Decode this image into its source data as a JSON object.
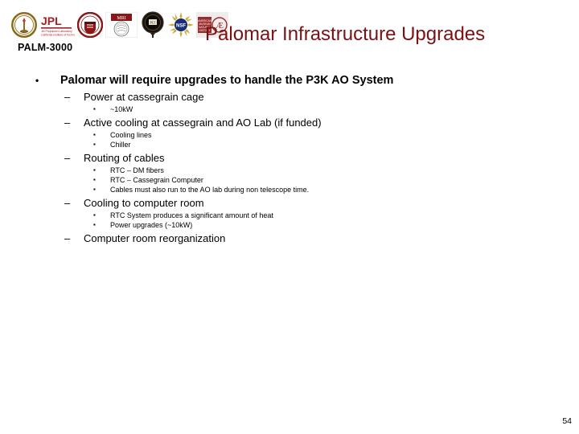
{
  "header": {
    "palm_label": "PALM-3000",
    "title": "Palomar Infrastructure Upgrades",
    "title_color": "#7B1113",
    "logos": [
      {
        "name": "caltech-seal-logo",
        "alt": "Caltech seal"
      },
      {
        "name": "jpl-logo",
        "alt": "JPL Jet Propulsion Laboratory California Institute of Technology"
      },
      {
        "name": "cornell-seal-logo",
        "alt": "Cornell University seal"
      },
      {
        "name": "university-crest-logo",
        "alt": "University crest"
      },
      {
        "name": "university-seal-dark-logo",
        "alt": "Dark university seal"
      },
      {
        "name": "nsf-logo",
        "alt": "National Science Foundation"
      },
      {
        "name": "partner-institution-logo",
        "alt": "Partner institution mark"
      }
    ]
  },
  "outline": [
    {
      "level": 1,
      "bullet": "•",
      "text": "Palomar will require upgrades to handle the P3K AO System"
    },
    {
      "level": 2,
      "bullet": "–",
      "text": "Power at cassegrain cage"
    },
    {
      "level": 3,
      "bullet": "▪",
      "text": "~10kW"
    },
    {
      "level": 2,
      "bullet": "–",
      "text": "Active cooling at cassegrain and AO Lab (if funded)"
    },
    {
      "level": 3,
      "bullet": "▪",
      "text": "Cooling lines"
    },
    {
      "level": 3,
      "bullet": "▪",
      "text": "Chiller"
    },
    {
      "level": 2,
      "bullet": "–",
      "text": "Routing of cables"
    },
    {
      "level": 3,
      "bullet": "▪",
      "text": "RTC – DM fibers"
    },
    {
      "level": 3,
      "bullet": "▪",
      "text": "RTC – Cassegrain Computer"
    },
    {
      "level": 3,
      "bullet": "▪",
      "text": "Cables must also run to the AO lab during non telescope time."
    },
    {
      "level": 2,
      "bullet": "–",
      "text": "Cooling to computer room"
    },
    {
      "level": 3,
      "bullet": "▪",
      "text": "RTC System produces a significant amount of heat"
    },
    {
      "level": 3,
      "bullet": "▪",
      "text": "Power upgrades (~10kW)"
    },
    {
      "level": 2,
      "bullet": "–",
      "text": "Computer room reorganization"
    }
  ],
  "footer": {
    "page_number": "54"
  }
}
